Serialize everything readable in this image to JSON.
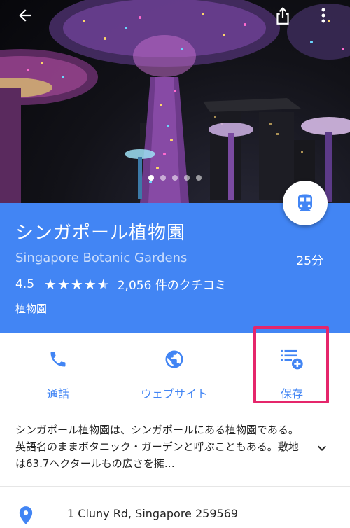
{
  "place": {
    "name_ja": "シンガポール植物園",
    "name_en": "Singapore Botanic Gardens",
    "travel_time": "25分",
    "rating": "4.5",
    "stars_value": 4.5,
    "reviews": "2,056 件のクチコミ",
    "category": "植物園"
  },
  "photo": {
    "page_count": 5,
    "current_page": 1
  },
  "actions": {
    "call": "通話",
    "website": "ウェブサイト",
    "save": "保存"
  },
  "description": "シンガポール植物園は、シンガポールにある植物園である。英語名のままボタニック・ガーデンと呼ぶこともある。敷地は63.7ヘクタールもの広さを擁…",
  "address": "1 Cluny Rd, Singapore 259569",
  "icons": {
    "back": "arrow-back-icon",
    "share": "share-icon",
    "more": "more-vert-icon",
    "transit": "train-icon",
    "call": "phone-icon",
    "website": "globe-icon",
    "save": "playlist-add-icon",
    "expand": "chevron-down-icon",
    "address": "location-pin-icon"
  },
  "colors": {
    "accent": "#4285f4",
    "highlight": "#e5266b"
  }
}
